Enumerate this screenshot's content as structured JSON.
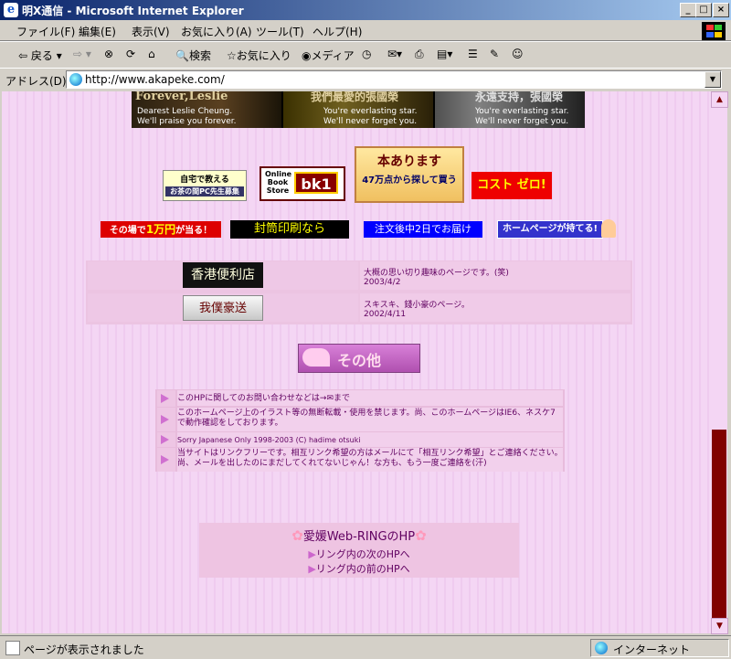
{
  "window": {
    "title": "明X通信 - Microsoft Internet Explorer",
    "controls": [
      "_",
      "□",
      "×"
    ]
  },
  "menu": [
    "ファイル(F)",
    "編集(E)",
    "表示(V)",
    "お気に入り(A)",
    "ツール(T)",
    "ヘルプ(H)"
  ],
  "toolbar": {
    "back": "戻る",
    "search": "検索",
    "favorites": "お気に入り",
    "media": "メディア"
  },
  "address": {
    "label": "アドレス(D)",
    "url": "http://www.akapeke.com/"
  },
  "banner": {
    "seg1_title": "Forever,Leslie",
    "seg1_line1": "Dearest Leslie Cheung.",
    "seg1_line2": "We'll praise you forever.",
    "seg2_title": "我們最愛的張國榮",
    "seg2_line1": "You're everlasting star.",
    "seg2_line2": "We'll never forget you.",
    "seg3_title": "永遠支持，張國榮",
    "seg3_line1": "You're everlasting star.",
    "seg3_line2": "We'll never forget you."
  },
  "ads": {
    "ad1_line1": "自宅で教える",
    "ad1_line2": "お茶の間PC先生募集",
    "ad2_line1": "Online",
    "ad2_line2": "Book",
    "ad2_line3": "Store",
    "ad2_logo": "bk1",
    "ad3_line1": "本あります",
    "ad3_line2": "47万点から探して買う",
    "ad4": "コスト ゼロ!",
    "ad5_prefix": "その場で",
    "ad5_highlight": "1万円",
    "ad5_suffix": "が当る！",
    "ad6": "封筒印刷なら",
    "ad7": "注文後中2日でお届け",
    "ad8": "ホームページが持てる!"
  },
  "links": [
    {
      "title": "香港便利店",
      "desc": "大概の思い切り趣味のページです。(笑)",
      "date": "2003/4/2"
    },
    {
      "title": "我僕豪送",
      "desc": "スキスキ、錢小豪のページ。",
      "date": "2002/4/11"
    }
  ],
  "section_title": "その他",
  "info": [
    "このHPに関してのお問い合わせなどは→✉まで",
    "このホームページ上のイラスト等の無断転載・使用を禁じます。尚、このホームページはIE6、ネスケ7で動作確認をしております。",
    "Sorry Japanese Only  1998-2003  (C) hadime otsuki",
    "当サイトはリンクフリーです。相互リンク希望の方はメールにて「相互リンク希望」とご連絡ください。尚、メールを出したのにまだしてくれてないじゃん！な方も、もう一度ご連絡を(汗)"
  ],
  "webring": {
    "title": "愛媛Web-RINGのHP",
    "next": "リング内の次のHPへ",
    "prev": "リング内の前のHPへ"
  },
  "status": {
    "text": "ページが表示されました",
    "zone": "インターネット"
  }
}
